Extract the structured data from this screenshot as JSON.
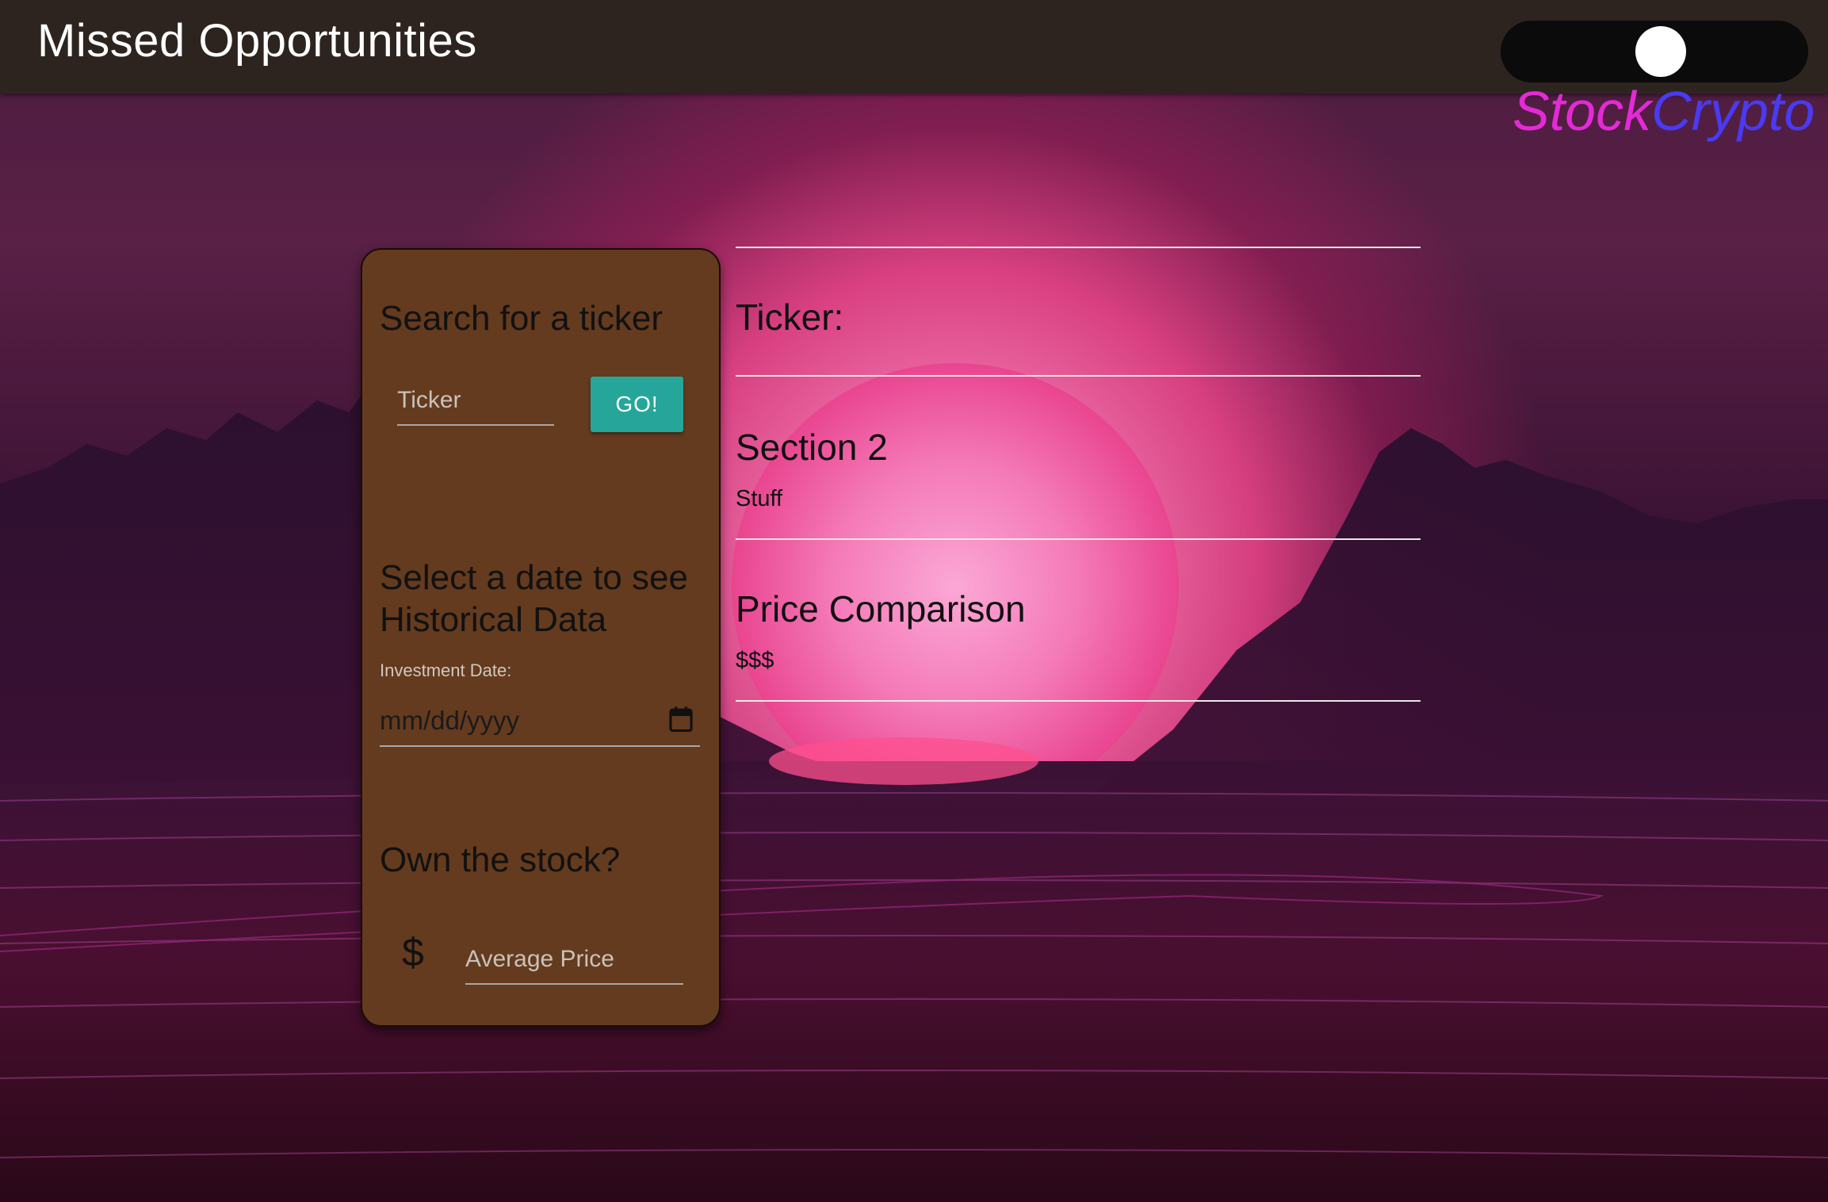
{
  "header": {
    "title": "Missed Opportunities",
    "toggle": {
      "left_label": "Stock",
      "right_label": "Crypto",
      "left_color": "#e42ad6",
      "right_color": "#4a3af0"
    }
  },
  "search_card": {
    "search_heading": "Search for a ticker",
    "ticker_placeholder": "Ticker",
    "go_label": "GO!",
    "date_heading": "Select a date to see Historical Data",
    "date_label": "Investment Date:",
    "date_placeholder": "mm/dd/yyyy",
    "own_heading": "Own the stock?",
    "currency_symbol": "$",
    "price_placeholder": "Average Price",
    "card_color": "#643b1e",
    "button_color": "#26a69a"
  },
  "results": {
    "ticker_label": "Ticker:",
    "section2_title": "Section 2",
    "section2_text": "Stuff",
    "comparison_title": "Price Comparison",
    "comparison_text": "$$$"
  }
}
